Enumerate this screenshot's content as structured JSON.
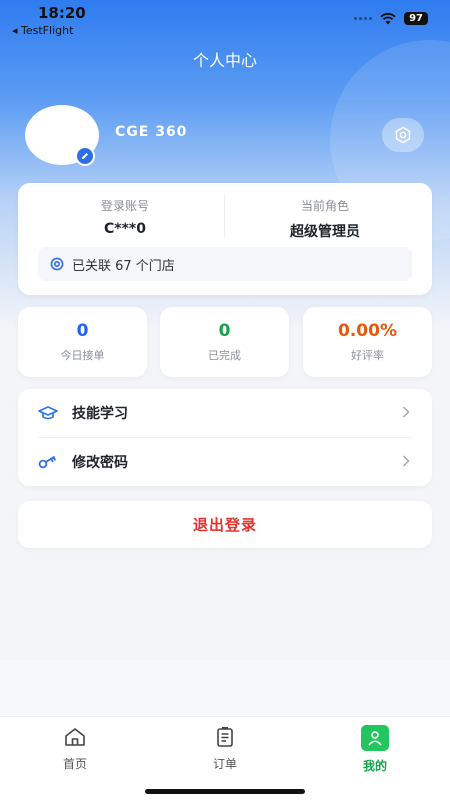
{
  "status_bar": {
    "time": "18:20",
    "back_app": "◂ TestFlight",
    "battery": "97"
  },
  "header": {
    "title": "个人中心"
  },
  "profile": {
    "username": "CGE 360"
  },
  "account": {
    "login_label": "登录账号",
    "login_value": "C***0",
    "role_label": "当前角色",
    "role_value": "超级管理员",
    "stores_text": "已关联 67 个门店"
  },
  "stats": [
    {
      "value": "0",
      "label": "今日接单",
      "color": "#2563eb"
    },
    {
      "value": "0",
      "label": "已完成",
      "color": "#16a34a"
    },
    {
      "value": "0.00%",
      "label": "好评率",
      "color": "#ea580c"
    }
  ],
  "menu": [
    {
      "label": "技能学习",
      "icon": "graduation-cap-icon"
    },
    {
      "label": "修改密码",
      "icon": "key-icon"
    }
  ],
  "logout": {
    "label": "退出登录"
  },
  "tabbar": [
    {
      "label": "首页",
      "icon": "home-icon"
    },
    {
      "label": "订单",
      "icon": "order-list-icon"
    },
    {
      "label": "我的",
      "icon": "user-icon",
      "active": true
    }
  ],
  "colors": {
    "brand": "#2f7cf0",
    "success": "#16a34a",
    "danger": "#e5322d"
  }
}
